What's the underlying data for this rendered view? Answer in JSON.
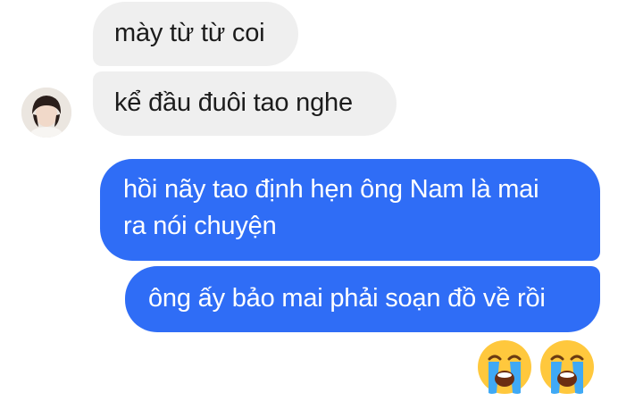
{
  "conversation": {
    "received": [
      {
        "text": "mày từ từ coi"
      },
      {
        "text": "kể đầu đuôi tao nghe"
      }
    ],
    "sent": [
      {
        "line1": "hồi nãy tao định hẹn ông Nam là mai",
        "line2": "ra nói chuyện"
      },
      {
        "text": "ông ấy bảo mai phải soạn đồ về rồi"
      }
    ],
    "reactions": [
      {
        "icon": "loudly-crying-face-icon",
        "glyph": "😭"
      },
      {
        "icon": "loudly-crying-face-icon",
        "glyph": "😭"
      }
    ]
  },
  "colors": {
    "received_bubble": "#efefef",
    "sent_bubble": "#2f6df6",
    "received_text": "#1c1c1c",
    "sent_text": "#ffffff"
  }
}
